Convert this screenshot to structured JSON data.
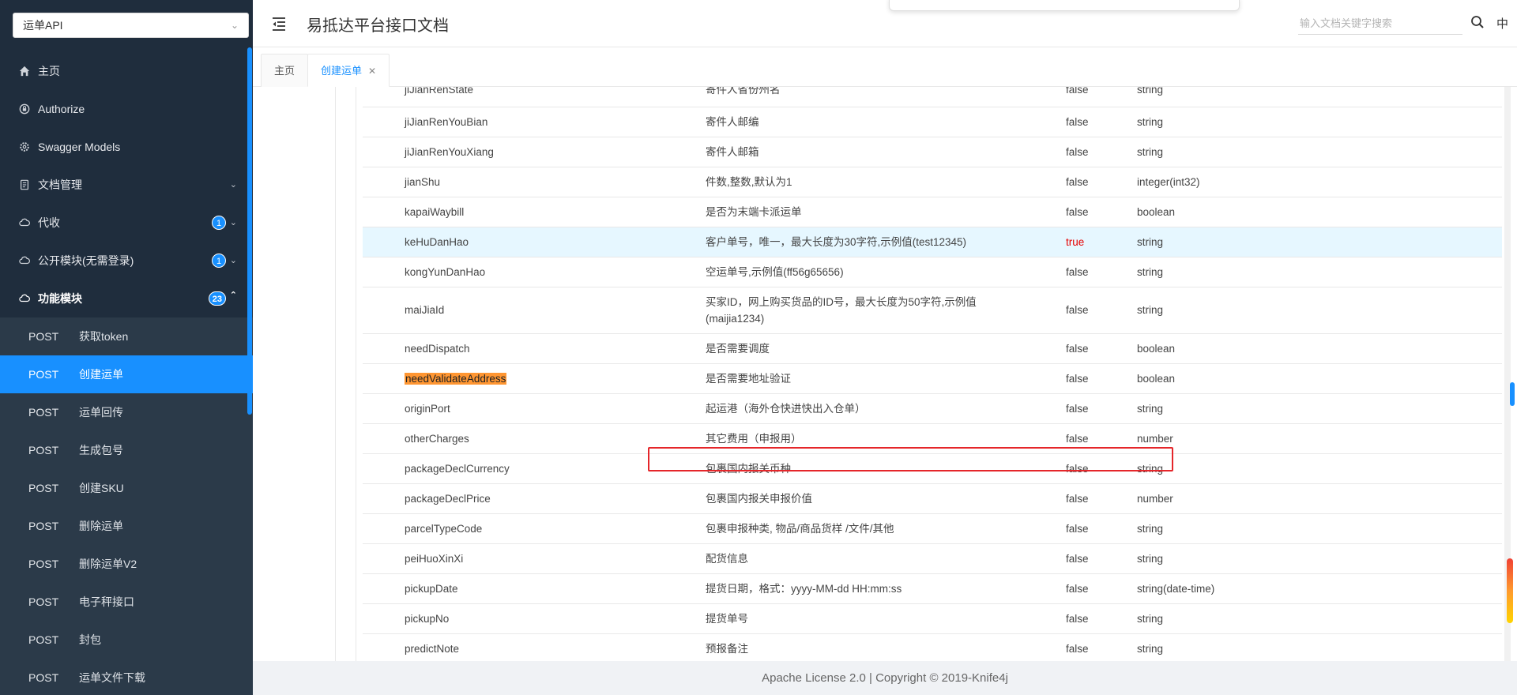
{
  "sidebar": {
    "group_select": {
      "value": "运单API"
    },
    "menu": [
      {
        "label": "主页",
        "icon": "home-icon"
      },
      {
        "label": "Authorize",
        "icon": "lock-icon"
      },
      {
        "label": "Swagger Models",
        "icon": "gear-icon"
      },
      {
        "label": "文档管理",
        "icon": "doc-icon"
      },
      {
        "label": "代收",
        "icon": "cloud-icon",
        "badge": "1"
      },
      {
        "label": "公开模块(无需登录)",
        "icon": "cloud-icon",
        "badge": "1"
      },
      {
        "label": "功能模块",
        "icon": "cloud-icon",
        "badge": "23"
      }
    ],
    "sub_items": [
      {
        "method": "POST",
        "label": "获取token"
      },
      {
        "method": "POST",
        "label": "创建运单"
      },
      {
        "method": "POST",
        "label": "运单回传"
      },
      {
        "method": "POST",
        "label": "生成包号"
      },
      {
        "method": "POST",
        "label": "创建SKU"
      },
      {
        "method": "POST",
        "label": "删除运单"
      },
      {
        "method": "POST",
        "label": "删除运单V2"
      },
      {
        "method": "POST",
        "label": "电子秤接口"
      },
      {
        "method": "POST",
        "label": "封包"
      },
      {
        "method": "POST",
        "label": "运单文件下载"
      }
    ]
  },
  "header": {
    "title": "易抵达平台接口文档",
    "search_placeholder": "输入文档关键字搜索",
    "lang": "中"
  },
  "tabs": [
    {
      "label": "主页"
    },
    {
      "label": "创建运单"
    }
  ],
  "params": [
    {
      "name": "jiJianRenState",
      "desc": "寄件人省份州名",
      "required": "false",
      "type": "string"
    },
    {
      "name": "jiJianRenYouBian",
      "desc": "寄件人邮编",
      "required": "false",
      "type": "string"
    },
    {
      "name": "jiJianRenYouXiang",
      "desc": "寄件人邮箱",
      "required": "false",
      "type": "string"
    },
    {
      "name": "jianShu",
      "desc": "件数,整数,默认为1",
      "required": "false",
      "type": "integer(int32)"
    },
    {
      "name": "kapaiWaybill",
      "desc": "是否为末端卡派运单",
      "required": "false",
      "type": "boolean"
    },
    {
      "name": "keHuDanHao",
      "desc": "客户单号，唯一，最大长度为30字符,示例值(test12345)",
      "required": "true",
      "type": "string"
    },
    {
      "name": "kongYunDanHao",
      "desc": "空运单号,示例值(ff56g65656)",
      "required": "false",
      "type": "string"
    },
    {
      "name": "maiJiaId",
      "desc": "买家ID，网上购买货品的ID号，最大长度为50字符,示例值(maijia1234)",
      "required": "false",
      "type": "string"
    },
    {
      "name": "needDispatch",
      "desc": "是否需要调度",
      "required": "false",
      "type": "boolean"
    },
    {
      "name": "needValidateAddress",
      "desc": "是否需要地址验证",
      "required": "false",
      "type": "boolean"
    },
    {
      "name": "originPort",
      "desc": "起运港（海外仓快进快出入仓单）",
      "required": "false",
      "type": "string"
    },
    {
      "name": "otherCharges",
      "desc": "其它费用（申报用）",
      "required": "false",
      "type": "number"
    },
    {
      "name": "packageDeclCurrency",
      "desc": "包裹国内报关币种",
      "required": "false",
      "type": "string"
    },
    {
      "name": "packageDeclPrice",
      "desc": "包裹国内报关申报价值",
      "required": "false",
      "type": "number"
    },
    {
      "name": "parcelTypeCode",
      "desc": "包裹申报种类, 物品/商品货样 /文件/其他",
      "required": "false",
      "type": "string"
    },
    {
      "name": "peiHuoXinXi",
      "desc": "配货信息",
      "required": "false",
      "type": "string"
    },
    {
      "name": "pickupDate",
      "desc": "提货日期，格式：yyyy-MM-dd HH:mm:ss",
      "required": "false",
      "type": "string(date-time)"
    },
    {
      "name": "pickupNo",
      "desc": "提货单号",
      "required": "false",
      "type": "string"
    },
    {
      "name": "predictNote",
      "desc": "预报备注",
      "required": "false",
      "type": "string"
    }
  ],
  "footer": {
    "text": "Apache License 2.0 | Copyright © 2019-Knife4j"
  },
  "colors": {
    "accent": "#1890ff",
    "sidebar_bg": "#1f2d3d",
    "required_true": "#e60000",
    "highlight_box": "#e5262a",
    "name_mark": "#ff9632"
  }
}
